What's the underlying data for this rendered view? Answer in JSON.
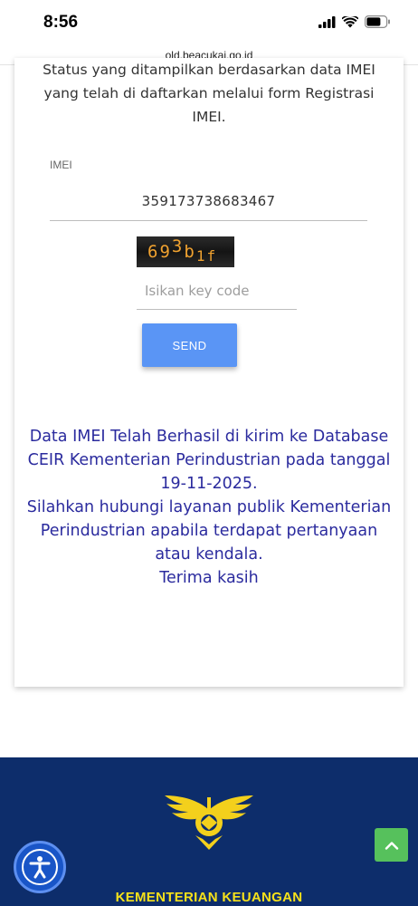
{
  "status_bar": {
    "time": "8:56"
  },
  "browser": {
    "url": "old.beacukai.go.id"
  },
  "form": {
    "intro_text": "Status yang ditampilkan berdasarkan data IMEI yang telah di daftarkan melalui form Registrasi IMEI.",
    "imei_label": "IMEI",
    "imei_value": "359173738683467",
    "captcha_text": "693b1f",
    "keycode_placeholder": "Isikan key code",
    "keycode_value": "",
    "send_label": "SEND"
  },
  "result": {
    "line1": "Data IMEI Telah Berhasil di kirim ke Database CEIR Kementerian Perindustrian pada tanggal 19-11-2025.",
    "line2": "Silahkan hubungi layanan publik Kementerian Perindustrian apabila terdapat pertanyaan atau kendala.",
    "line3": "Terima kasih"
  },
  "footer": {
    "title": "KEMENTERIAN KEUANGAN"
  },
  "icons": {
    "signal": "signal-icon",
    "wifi": "wifi-icon",
    "battery": "battery-icon",
    "emblem": "customs-emblem-icon",
    "scroll_top": "chevron-up-icon",
    "accessibility": "accessibility-icon"
  },
  "colors": {
    "accent_button": "#5a95f5",
    "result_text": "#2b2b9e",
    "footer_bg": "#0d2d6b",
    "footer_title": "#f6e11a",
    "scroll_top_bg": "#56c15c",
    "accessibility_bg": "#1955c7"
  }
}
